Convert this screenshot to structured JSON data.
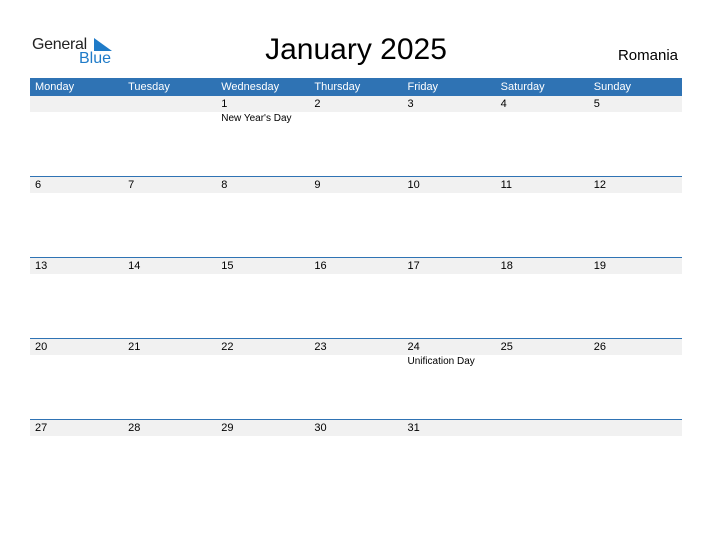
{
  "logo": {
    "line1": "General",
    "line2": "Blue"
  },
  "title": "January 2025",
  "country": "Romania",
  "colors": {
    "header_bg": "#2f73b4",
    "date_band": "#f1f1f1",
    "logo_blue": "#1f7bc8"
  },
  "weekdays": [
    "Monday",
    "Tuesday",
    "Wednesday",
    "Thursday",
    "Friday",
    "Saturday",
    "Sunday"
  ],
  "weeks": [
    [
      {
        "d": "",
        "h": ""
      },
      {
        "d": "",
        "h": ""
      },
      {
        "d": "1",
        "h": "New Year's Day"
      },
      {
        "d": "2",
        "h": ""
      },
      {
        "d": "3",
        "h": ""
      },
      {
        "d": "4",
        "h": ""
      },
      {
        "d": "5",
        "h": ""
      }
    ],
    [
      {
        "d": "6",
        "h": ""
      },
      {
        "d": "7",
        "h": ""
      },
      {
        "d": "8",
        "h": ""
      },
      {
        "d": "9",
        "h": ""
      },
      {
        "d": "10",
        "h": ""
      },
      {
        "d": "11",
        "h": ""
      },
      {
        "d": "12",
        "h": ""
      }
    ],
    [
      {
        "d": "13",
        "h": ""
      },
      {
        "d": "14",
        "h": ""
      },
      {
        "d": "15",
        "h": ""
      },
      {
        "d": "16",
        "h": ""
      },
      {
        "d": "17",
        "h": ""
      },
      {
        "d": "18",
        "h": ""
      },
      {
        "d": "19",
        "h": ""
      }
    ],
    [
      {
        "d": "20",
        "h": ""
      },
      {
        "d": "21",
        "h": ""
      },
      {
        "d": "22",
        "h": ""
      },
      {
        "d": "23",
        "h": ""
      },
      {
        "d": "24",
        "h": "Unification Day"
      },
      {
        "d": "25",
        "h": ""
      },
      {
        "d": "26",
        "h": ""
      }
    ],
    [
      {
        "d": "27",
        "h": ""
      },
      {
        "d": "28",
        "h": ""
      },
      {
        "d": "29",
        "h": ""
      },
      {
        "d": "30",
        "h": ""
      },
      {
        "d": "31",
        "h": ""
      },
      {
        "d": "",
        "h": ""
      },
      {
        "d": "",
        "h": ""
      }
    ]
  ]
}
